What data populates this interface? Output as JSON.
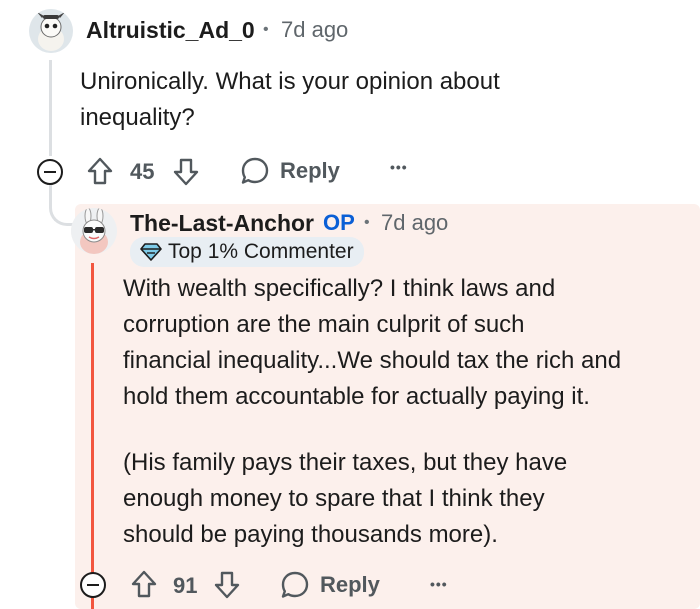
{
  "comment1": {
    "username": "Altruistic_Ad_0",
    "time": "7d ago",
    "body_lines": [
      "Unironically. What is your opinion about",
      "inequality?"
    ],
    "score": "45",
    "reply_label": "Reply",
    "more_label": "•••"
  },
  "comment2": {
    "username": "The-Last-Anchor",
    "op_label": "OP",
    "time": "7d ago",
    "badge_label": "Top 1% Commenter",
    "paragraph1": [
      "With wealth specifically? I think laws and",
      "corruption are the main culprit of such",
      "financial inequality...We should tax the rich and",
      "hold them accountable for actually paying it."
    ],
    "paragraph2": [
      "(His family pays their taxes, but they have",
      "enough money to spare that I think they",
      "should be paying thousands more)."
    ],
    "score": "91",
    "reply_label": "Reply",
    "more_label": "•••"
  },
  "colors": {
    "op_accent": "#f2563f",
    "op_label": "#0a5fd6",
    "highlight_bg": "#fcf0ec"
  },
  "icons": [
    "avatar-snoo",
    "upvote-icon",
    "downvote-icon",
    "reply-bubble-icon",
    "collapse-icon",
    "more-icon",
    "diamond-badge-icon"
  ]
}
